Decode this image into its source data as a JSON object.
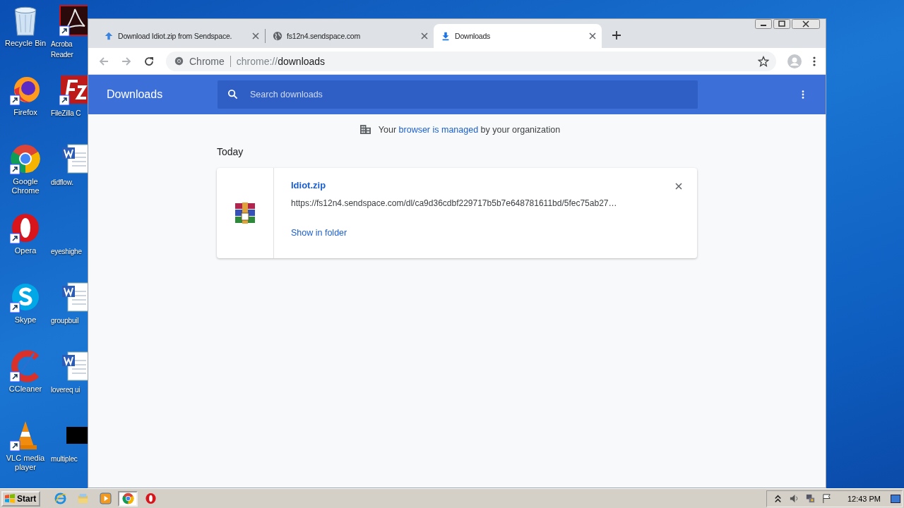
{
  "desktop": {
    "icons": [
      {
        "label": "Recycle Bin",
        "kind": "recycle"
      },
      {
        "label": "Acroba",
        "label_2": "Reader",
        "kind": "acrobat"
      },
      {
        "label": "Firefox",
        "kind": "firefox"
      },
      {
        "label": "FileZilla C",
        "kind": "filezilla"
      },
      {
        "label": "Google Chrome",
        "kind": "chrome"
      },
      {
        "label": "didflow.",
        "kind": "word"
      },
      {
        "label": "Opera",
        "kind": "opera"
      },
      {
        "label": "eyeshighe",
        "kind": "none"
      },
      {
        "label": "Skype",
        "kind": "skype"
      },
      {
        "label": "groupbuil",
        "kind": "word"
      },
      {
        "label": "CCleaner",
        "kind": "ccleaner"
      },
      {
        "label": "lovereq ui",
        "kind": "word"
      },
      {
        "label": "VLC media player",
        "kind": "vlc"
      },
      {
        "label": "multiplec",
        "kind": "black"
      }
    ]
  },
  "browser": {
    "tabs": [
      {
        "title": "Download Idiot.zip from Sendspace.",
        "kind": "upload",
        "selected": false
      },
      {
        "title": "fs12n4.sendspace.com",
        "kind": "globe",
        "selected": false
      },
      {
        "title": "Downloads",
        "kind": "download",
        "selected": true
      }
    ],
    "address": {
      "label": "Chrome",
      "scheme": "chrome://",
      "path": "downloads"
    },
    "page": {
      "title": "Downloads",
      "search": {
        "placeholder": "Search downloads"
      },
      "notice": {
        "before": "Your",
        "link": "browser is managed",
        "after": "by your organization"
      },
      "date_heading": "Today",
      "downloads": [
        {
          "file_name": "Idiot.zip",
          "url": "https://fs12n4.sendspace.com/dl/ca9d36cdbf229717b5b7e648781611bd/5fec75ab27…",
          "action": "Show in folder"
        }
      ]
    }
  },
  "taskbar": {
    "start": "Start",
    "apps": [
      {
        "kind": "ie",
        "selected": false
      },
      {
        "kind": "explorer",
        "selected": false
      },
      {
        "kind": "media",
        "selected": false
      },
      {
        "kind": "chrome",
        "selected": true
      },
      {
        "kind": "opera",
        "selected": false
      }
    ],
    "clock": "12:43 PM"
  }
}
